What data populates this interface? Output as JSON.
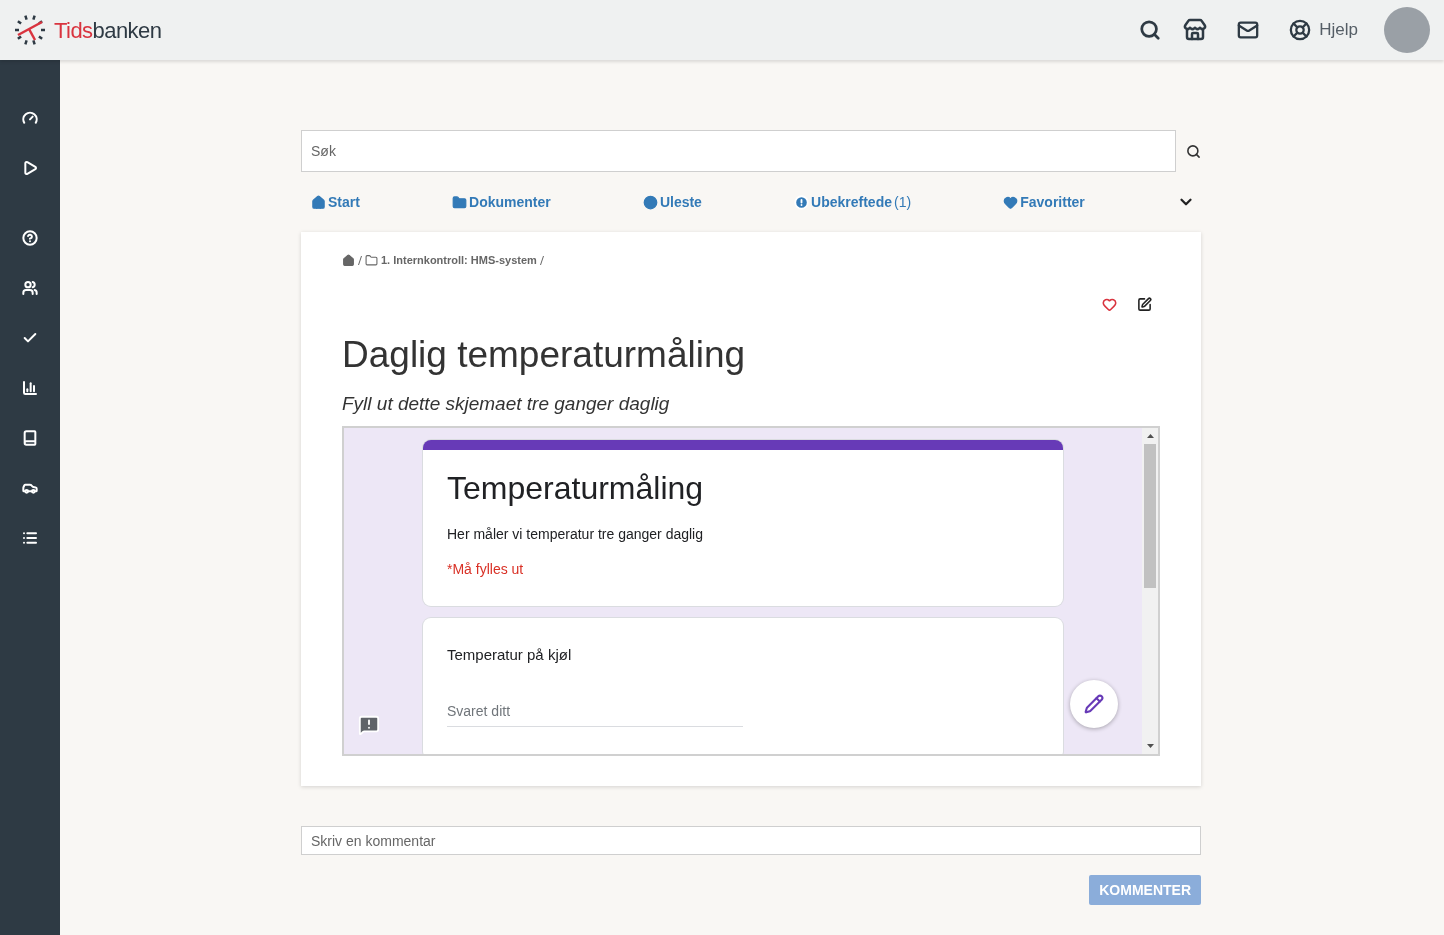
{
  "header": {
    "logo": {
      "part_1": "Tids",
      "part_2": "banken"
    },
    "help_label": "Hjelp"
  },
  "search": {
    "placeholder": "Søk"
  },
  "nav_tabs": [
    {
      "kind": "home",
      "label": "Start"
    },
    {
      "kind": "folder",
      "label": "Dokumenter"
    },
    {
      "kind": "circle",
      "label": "Uleste"
    },
    {
      "kind": "alert",
      "label": "Ubekreftede",
      "count": "(1)"
    },
    {
      "kind": "heart",
      "label": "Favoritter"
    }
  ],
  "document": {
    "breadcrumb": [
      "1. Internkontroll: HMS-system"
    ],
    "favorite": false,
    "title": "Daglig temperaturmåling",
    "subtitle": "Fyll ut dette skjemaet tre ganger daglig",
    "form": {
      "title": "Temperaturmåling",
      "description": "Her måler vi temperatur tre ganger daglig",
      "required_note": "*Må fylles ut",
      "questions": [
        {
          "label": "Temperatur på kjøl",
          "placeholder": "Svaret ditt"
        }
      ]
    }
  },
  "comment": {
    "placeholder": "Skriv en kommentar",
    "button": "KOMMENTER",
    "disabled": true
  }
}
